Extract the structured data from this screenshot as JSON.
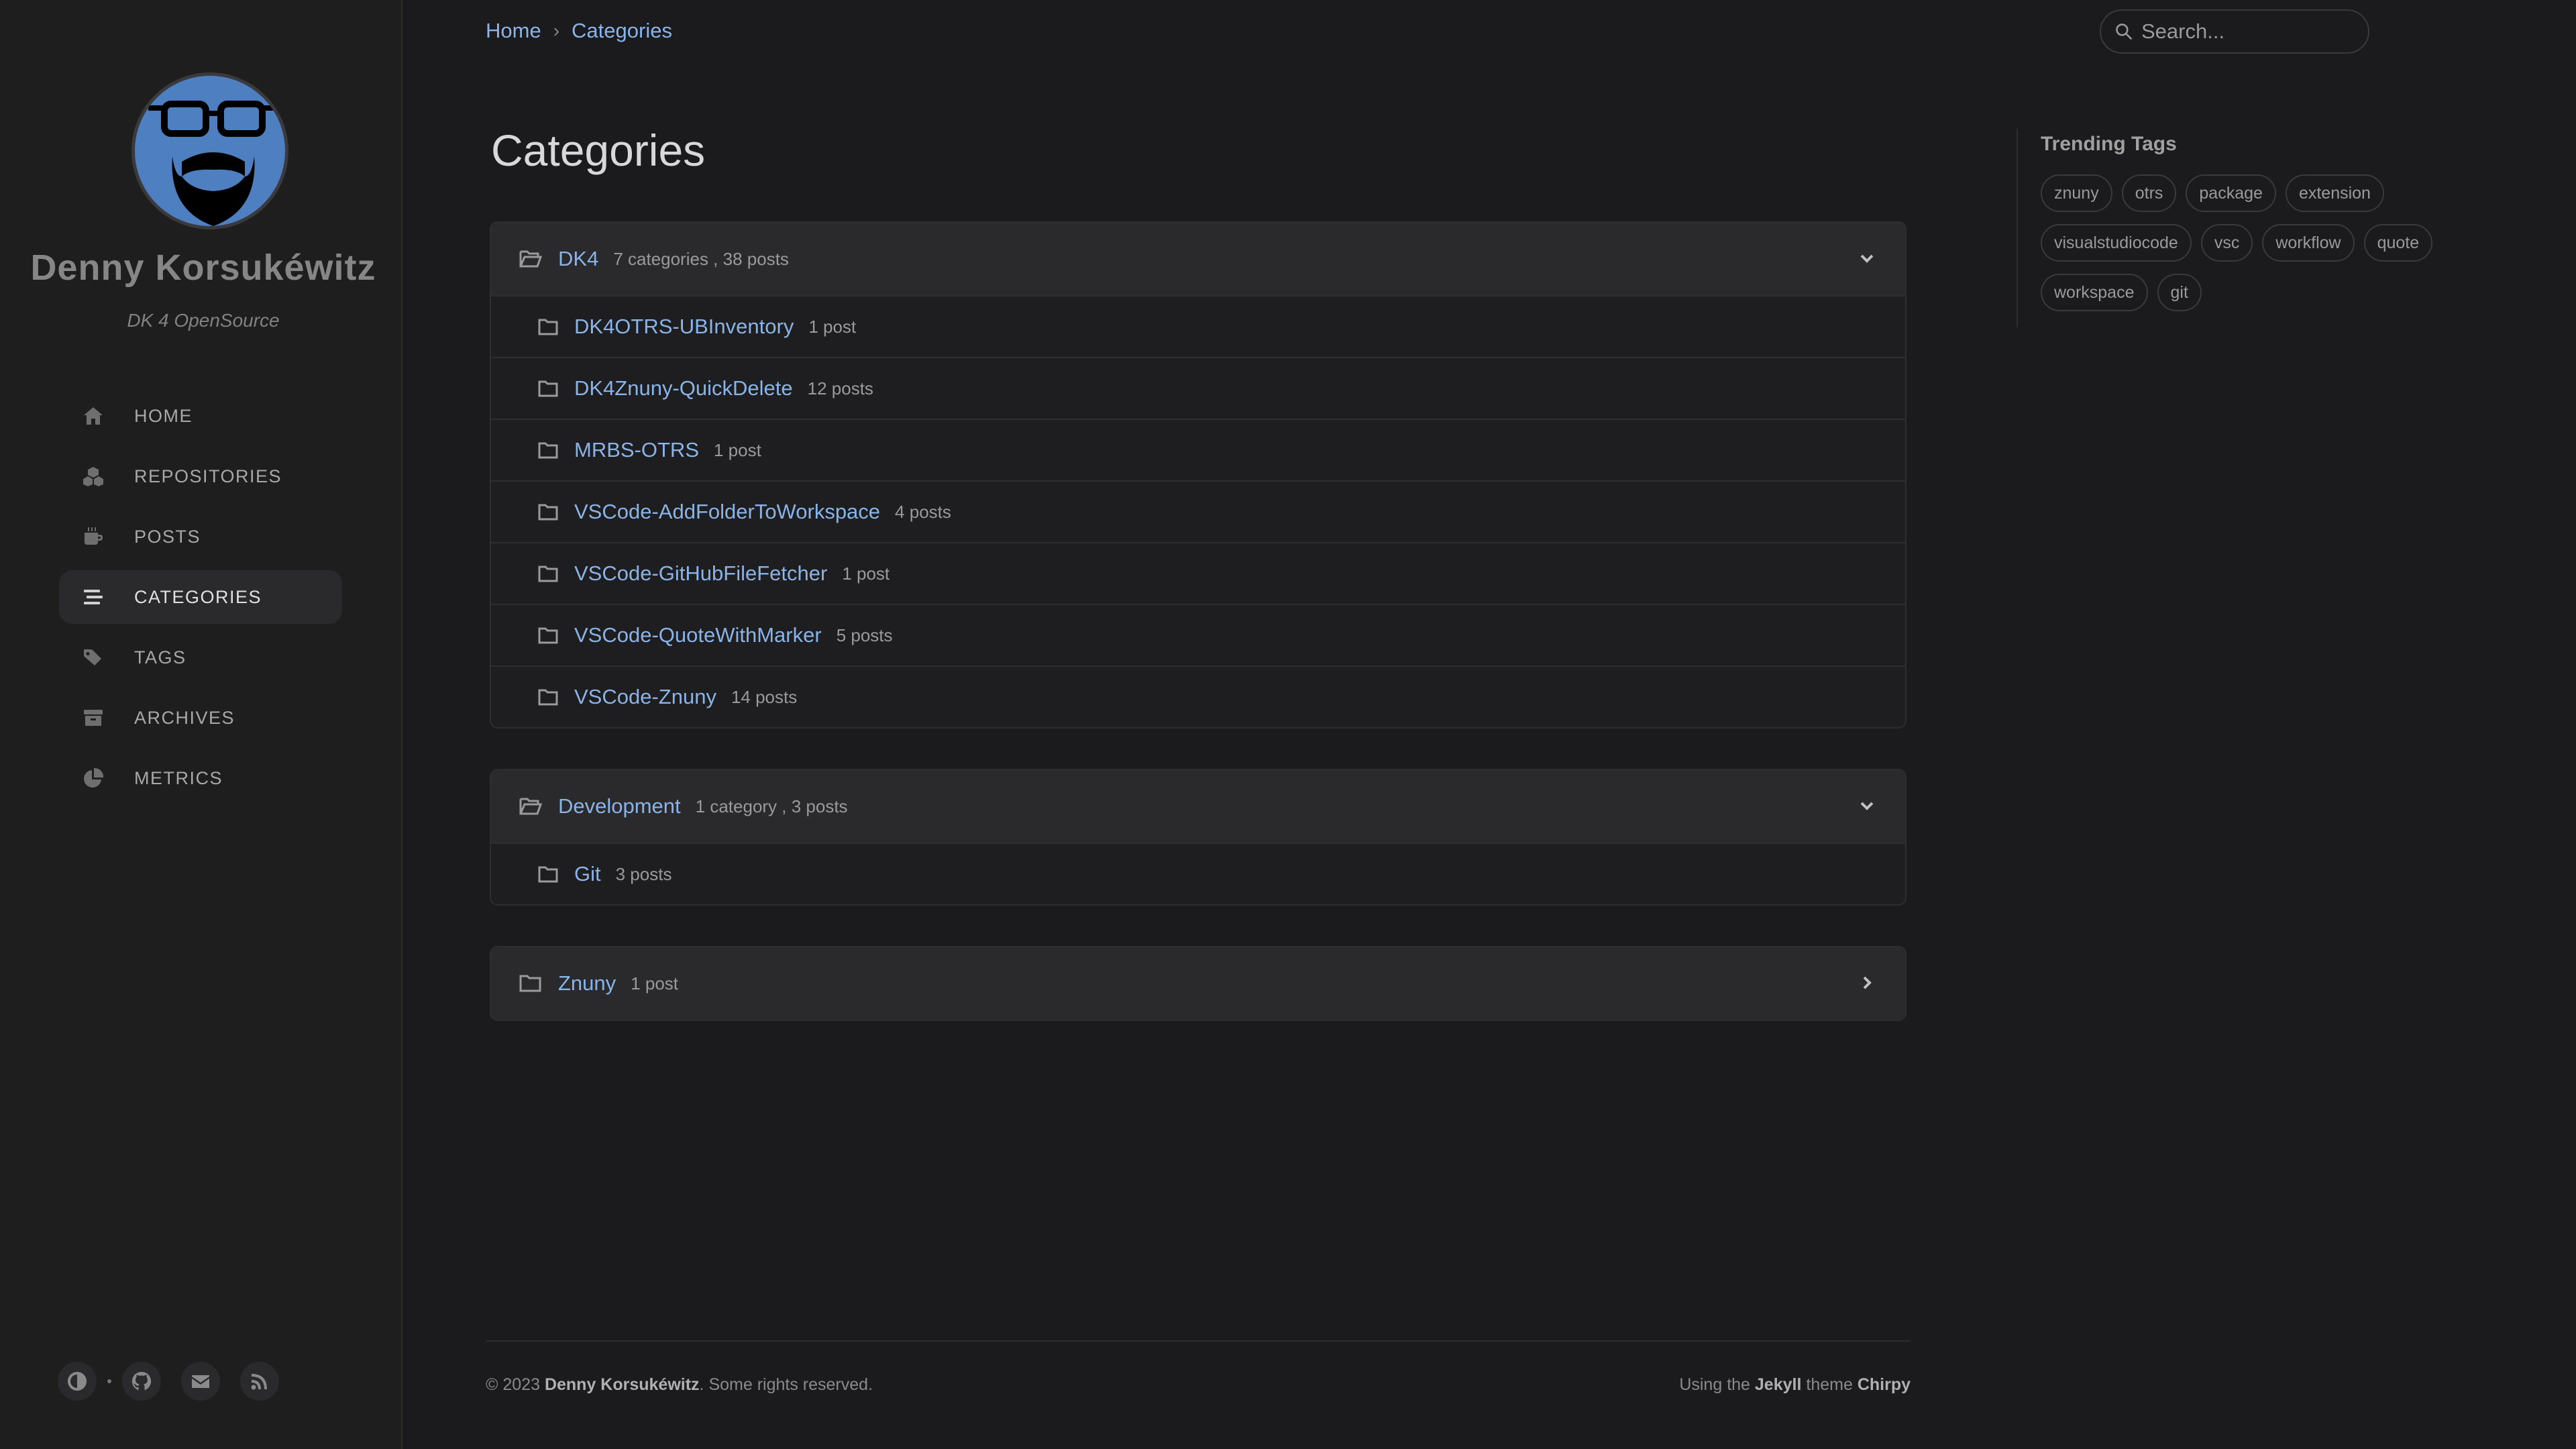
{
  "sidebar": {
    "title": "Denny Korsukéwitz",
    "subtitle": "DK 4 OpenSource",
    "nav": [
      {
        "label": "HOME",
        "icon": "home-icon"
      },
      {
        "label": "REPOSITORIES",
        "icon": "cubes-icon"
      },
      {
        "label": "POSTS",
        "icon": "mug-icon"
      },
      {
        "label": "CATEGORIES",
        "icon": "stream-icon"
      },
      {
        "label": "TAGS",
        "icon": "tags-icon"
      },
      {
        "label": "ARCHIVES",
        "icon": "archive-icon"
      },
      {
        "label": "METRICS",
        "icon": "pie-chart-icon"
      }
    ]
  },
  "breadcrumb": {
    "home": "Home",
    "sep": "›",
    "current": "Categories"
  },
  "search": {
    "placeholder": "Search..."
  },
  "page_title": "Categories",
  "categories": [
    {
      "name": "DK4",
      "meta": "7 categories , 38 posts",
      "children": [
        {
          "name": "DK4OTRS-UBInventory",
          "meta": "1 post"
        },
        {
          "name": "DK4Znuny-QuickDelete",
          "meta": "12 posts"
        },
        {
          "name": "MRBS-OTRS",
          "meta": "1 post"
        },
        {
          "name": "VSCode-AddFolderToWorkspace",
          "meta": "4 posts"
        },
        {
          "name": "VSCode-GitHubFileFetcher",
          "meta": "1 post"
        },
        {
          "name": "VSCode-QuoteWithMarker",
          "meta": "5 posts"
        },
        {
          "name": "VSCode-Znuny",
          "meta": "14 posts"
        }
      ]
    },
    {
      "name": "Development",
      "meta": "1 category , 3 posts",
      "children": [
        {
          "name": "Git",
          "meta": "3 posts"
        }
      ]
    },
    {
      "name": "Znuny",
      "meta": "1 post",
      "children": []
    }
  ],
  "trending": {
    "title": "Trending Tags",
    "tags": [
      "znuny",
      "otrs",
      "package",
      "extension",
      "visualstudiocode",
      "vsc",
      "workflow",
      "quote",
      "workspace",
      "git"
    ]
  },
  "footer": {
    "copyright_prefix": "© 2023",
    "author": "Denny Korsukéwitz",
    "rights": ". Some rights reserved.",
    "using": "Using the",
    "jekyll": "Jekyll",
    "theme_word": "theme",
    "chirpy": "Chirpy"
  }
}
